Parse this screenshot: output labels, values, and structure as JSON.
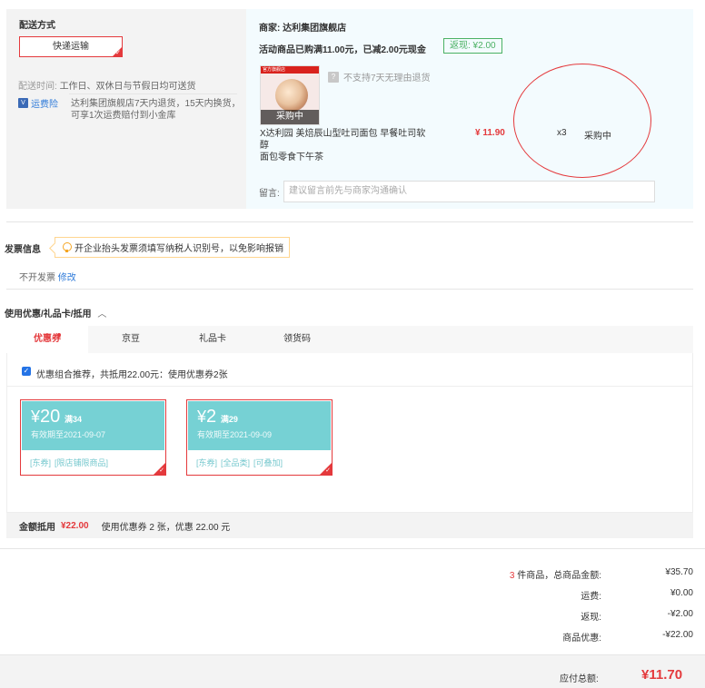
{
  "shipping": {
    "title": "配送方式",
    "method_label": "快递运输",
    "time_label": "配送时间:",
    "time_value": "工作日、双休日与节假日均可送货",
    "insurance_badge": "运费险",
    "insurance_text_1": "达利集团旗舰店7天内退货，15天内换货，",
    "insurance_text_2": "可享1次运费赔付到小金库"
  },
  "store": {
    "seller_label": "商家:",
    "seller_name": "达利集团旗舰店",
    "promo": "活动商品已购满11.00元，已减2.00元现金",
    "rebate": "返现: ¥2.00",
    "product": {
      "thumb_tag": "官方旗舰店",
      "status_overlay": "采购中",
      "no_return": "不支持7天无理由退货",
      "name_line1": "X达利园 美焙辰山型吐司面包 早餐吐司软醇",
      "name_line2": "面包零食下午茶",
      "price": "¥ 11.90",
      "qty": "x3",
      "status": "采购中"
    },
    "memo_label": "留言:",
    "memo_placeholder": "建议留言前先与商家沟通确认"
  },
  "invoice": {
    "title": "发票信息",
    "tip": "开企业抬头发票须填写纳税人识别号，以免影响报销",
    "value": "不开发票",
    "edit_link": "修改"
  },
  "discount": {
    "title": "使用优惠/礼品卡/抵用",
    "tabs": [
      "优惠券",
      "京豆",
      "礼品卡",
      "领货码"
    ],
    "combo_text": "优惠组合推荐，共抵用22.00元：使用优惠券2张",
    "coupons": [
      {
        "currency": "¥",
        "amount": "20",
        "condition": "满34",
        "expiry": "有效期至2021-09-07",
        "tags": [
          "[东券]",
          "[限店铺限商品]"
        ]
      },
      {
        "currency": "¥",
        "amount": "2",
        "condition": "满29",
        "expiry": "有效期至2021-09-09",
        "tags": [
          "[东券]",
          "[全品类]",
          "[可叠加]"
        ]
      }
    ],
    "total_label": "金额抵用",
    "total_value": "¥22.00",
    "total_desc": "使用优惠券 2 张，优惠 22.00 元"
  },
  "summary": {
    "count": "3",
    "items_label": "件商品，总商品金额:",
    "items_value": "¥35.70",
    "freight_label": "运费:",
    "freight_value": "¥0.00",
    "rebate_label": "返现:",
    "rebate_value": "-¥2.00",
    "discount_label": "商品优惠:",
    "discount_value": "-¥22.00",
    "payable_label": "应付总额:",
    "payable_value": "¥11.70"
  },
  "colors": {
    "accent": "#e4393c",
    "coupon": "#76d1d4",
    "rebate": "#4bb164",
    "link": "#2e7ad9"
  }
}
